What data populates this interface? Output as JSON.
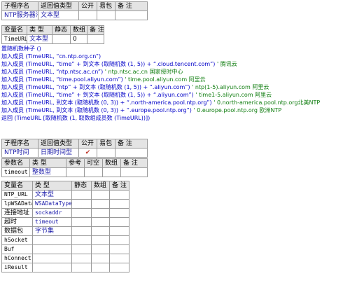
{
  "sub1": {
    "headers": [
      "子程序名",
      "返回值类型",
      "公开",
      "易包",
      "备 注"
    ],
    "name": "NTP服务器池",
    "return_type": "文本型"
  },
  "var1": {
    "headers": [
      "变量名",
      "类 型",
      "静态",
      "数组",
      "备 注"
    ],
    "name": "TimeURL",
    "type": "文本型",
    "array": "0"
  },
  "code": [
    {
      "cmd": "置随机数种子 ()",
      "comment": ""
    },
    {
      "cmd": "加入成员 (TimeURL, “cn.ntp.org.cn”)",
      "comment": ""
    },
    {
      "cmd": "加入成员 (TimeURL, “time” + 到文本 (取随机数 (1, 5)) + “.cloud.tencent.com”)",
      "comment": "' 腾讯云"
    },
    {
      "cmd": "加入成员 (TimeURL, “ntp.ntsc.ac.cn”)",
      "comment": "' ntp.ntsc.ac.cn 国家授时中心"
    },
    {
      "cmd": "加入成员 (TimeURL, “time.pool.aliyun.com”)",
      "comment": "' time.pool.aliyun.com 阿里云"
    },
    {
      "cmd": "加入成员 (TimeURL, “ntp” + 到文本 (取随机数 (1, 5)) + “.aliyun.com”)",
      "comment": "' ntp(1-5).aliyun.com 阿里云"
    },
    {
      "cmd": "加入成员 (TimeURL, “time” + 到文本 (取随机数 (1, 5)) + “.aliyun.com”)",
      "comment": "' time1-5.aliyun.com 阿里云"
    },
    {
      "cmd": "加入成员 (TimeURL, 到文本 (取随机数 (0, 3)) + “.north-america.pool.ntp.org”)",
      "comment": "' 0.north-america.pool.ntp.org北美NTP"
    },
    {
      "cmd": "加入成员 (TimeURL, 到文本 (取随机数 (0, 3)) + “.europe.pool.ntp.org”)",
      "comment": "' 0.europe.pool.ntp.org 欧洲NTP"
    },
    {
      "cmd": "返回 (TimeURL [取随机数 (1, 取数组成员数 (TimeURL))])",
      "comment": ""
    }
  ],
  "sub2": {
    "headers": [
      "子程序名",
      "返回值类型",
      "公开",
      "易包",
      "备 注"
    ],
    "name": "NTP时间",
    "return_type": "日期时间型",
    "public_mark": "✔"
  },
  "param2": {
    "headers": [
      "参数名",
      "类 型",
      "参考",
      "可空",
      "数组",
      "备 注"
    ],
    "name": "timeout",
    "type": "整数型"
  },
  "var2": {
    "headers": [
      "变量名",
      "类 型",
      "静态",
      "数组",
      "备 注"
    ],
    "rows": [
      {
        "name": "NTP_URL",
        "type": "文本型"
      },
      {
        "name": "lpWSAData",
        "type": "WSADataType"
      },
      {
        "name": "连接地址",
        "type": "sockaddr"
      },
      {
        "name": "超时",
        "type": "timeout"
      },
      {
        "name": "数据包",
        "type": "字节集"
      },
      {
        "name": "hSocket",
        "type": ""
      },
      {
        "name": "Buf",
        "type": ""
      },
      {
        "name": "hConnect",
        "type": ""
      },
      {
        "name": "iResult",
        "type": ""
      }
    ]
  }
}
